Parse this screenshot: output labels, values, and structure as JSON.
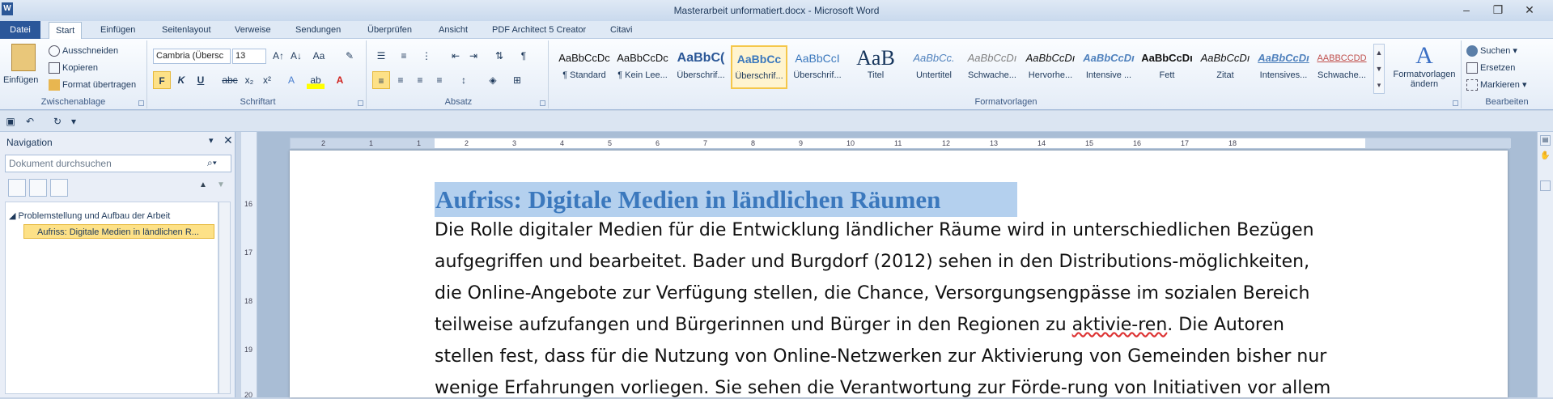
{
  "window": {
    "title": "Masterarbeit unformatiert.docx - Microsoft Word",
    "app_icon": "W",
    "controls": {
      "minimize": "–",
      "restore": "❐",
      "close": "✕"
    }
  },
  "tabs": [
    "Datei",
    "Start",
    "Einfügen",
    "Seitenlayout",
    "Verweise",
    "Sendungen",
    "Überprüfen",
    "Ansicht",
    "PDF Architect 5 Creator",
    "Citavi"
  ],
  "ribbon": {
    "clipboard": {
      "label": "Zwischenablage",
      "paste": "Einfügen",
      "cut": "Ausschneiden",
      "copy": "Kopieren",
      "format_painter": "Format übertragen"
    },
    "font": {
      "label": "Schriftart",
      "family": "Cambria (Übersc",
      "size": "13",
      "bold": "F",
      "italic": "K",
      "underline": "U"
    },
    "paragraph": {
      "label": "Absatz"
    },
    "styles": {
      "label": "Formatvorlagen",
      "items": [
        {
          "sample": "AaBbCcDc",
          "name": "¶ Standard"
        },
        {
          "sample": "AaBbCcDc",
          "name": "¶ Kein Lee..."
        },
        {
          "sample": "AaBbC(",
          "name": "Überschrif..."
        },
        {
          "sample": "AaBbCc",
          "name": "Überschrif..."
        },
        {
          "sample": "AaBbCcI",
          "name": "Überschrif..."
        },
        {
          "sample": "AaB",
          "name": "Titel"
        },
        {
          "sample": "AaBbCc.",
          "name": "Untertitel"
        },
        {
          "sample": "AaBbCcDı",
          "name": "Schwache..."
        },
        {
          "sample": "AaBbCcDı",
          "name": "Hervorhe..."
        },
        {
          "sample": "AaBbCcDı",
          "name": "Intensive ..."
        },
        {
          "sample": "AaBbCcDı",
          "name": "Fett"
        },
        {
          "sample": "AaBbCcDı",
          "name": "Zitat"
        },
        {
          "sample": "AaBbCcDı",
          "name": "Intensives..."
        },
        {
          "sample": "AABBCCDD",
          "name": "Schwache..."
        }
      ],
      "change": "Formatvorlagen\nändern"
    },
    "editing": {
      "label": "Bearbeiten",
      "find": "Suchen",
      "replace": "Ersetzen",
      "select": "Markieren"
    }
  },
  "navigation": {
    "title": "Navigation",
    "search_placeholder": "Dokument durchsuchen",
    "tree": [
      {
        "label": "Problemstellung und Aufbau der Arbeit"
      },
      {
        "label": "Aufriss: Digitale Medien in ländlichen R..."
      }
    ]
  },
  "ruler": {
    "marks": [
      "2",
      "1",
      "1",
      "2",
      "3",
      "4",
      "5",
      "6",
      "7",
      "8",
      "9",
      "10",
      "11",
      "12",
      "13",
      "14",
      "15",
      "16",
      "17",
      "18"
    ]
  },
  "vruler": {
    "marks": [
      "16",
      "17",
      "18",
      "19",
      "20"
    ]
  },
  "document": {
    "heading": "Aufriss: Digitale Medien in ländlichen Räumen",
    "lines": [
      "Die Rolle digitaler Medien für die Entwicklung ländlicher Räume wird in unterschiedlichen Bezügen",
      "aufgegriffen und bearbeitet. Bader und Burgdorf (2012) sehen in den Distributions-möglichkeiten,",
      "die Online-Angebote zur Verfügung stellen, die Chance, Versorgungsengpässe im sozialen Bereich",
      "teilweise aufzufangen und Bürgerinnen und Bürger in den Regionen zu ",
      "stellen fest, dass für die Nutzung von Online-Netzwerken zur Aktivierung von Gemeinden bisher nur",
      "wenige Erfahrungen vorliegen. Sie sehen die Verantwortung zur Förde-rung von Initiativen vor allem"
    ],
    "misspelled": "aktivie-ren",
    "line4_tail": ". Die Autoren"
  },
  "colors": {
    "heading": "#3b78bd",
    "highlight": "#b4d0ee",
    "file_tab": "#2b579a"
  }
}
